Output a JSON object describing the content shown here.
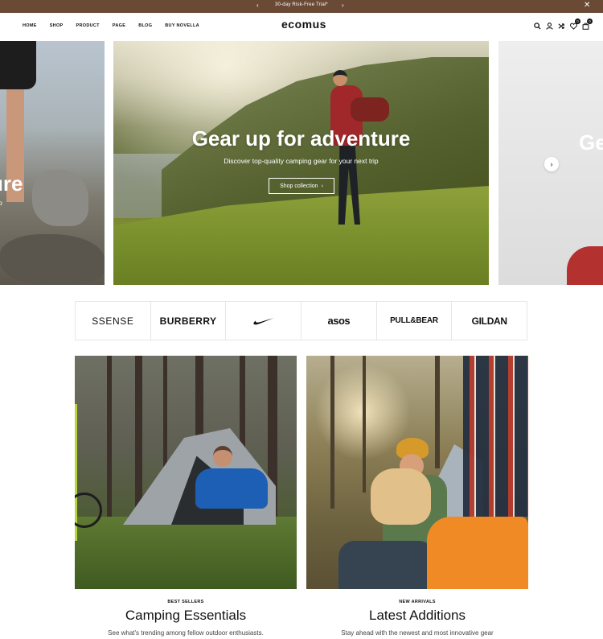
{
  "announcement": {
    "text": "30-day Risk-Free Trial*",
    "prev": "‹",
    "next": "›",
    "close": "✕"
  },
  "header": {
    "nav": [
      "HOME",
      "SHOP",
      "PRODUCT",
      "PAGE",
      "BLOG",
      "BUY NOVELLA"
    ],
    "logo": "ecomus",
    "wishlist_count": "0",
    "cart_count": "0"
  },
  "hero": {
    "title": "Gear up for adventure",
    "subtitle": "Discover top-quality camping gear for your next trip",
    "button": "Shop collection",
    "button_arrow": "›",
    "left_partial_title": "ure",
    "left_partial_sub": "p",
    "right_partial_title": "Ge",
    "next_arrow": "›"
  },
  "brands": [
    "SSENSE",
    "BURBERRY",
    "nike",
    "asos",
    "PULL&BEAR",
    "GILDAN"
  ],
  "collections": [
    {
      "eyebrow": "BEST SELLERS",
      "title": "Camping Essentials",
      "description": "See what's trending among fellow outdoor enthusiasts."
    },
    {
      "eyebrow": "NEW ARRIVALS",
      "title": "Latest Additions",
      "description": "Stay ahead with the newest and most innovative gear"
    }
  ]
}
